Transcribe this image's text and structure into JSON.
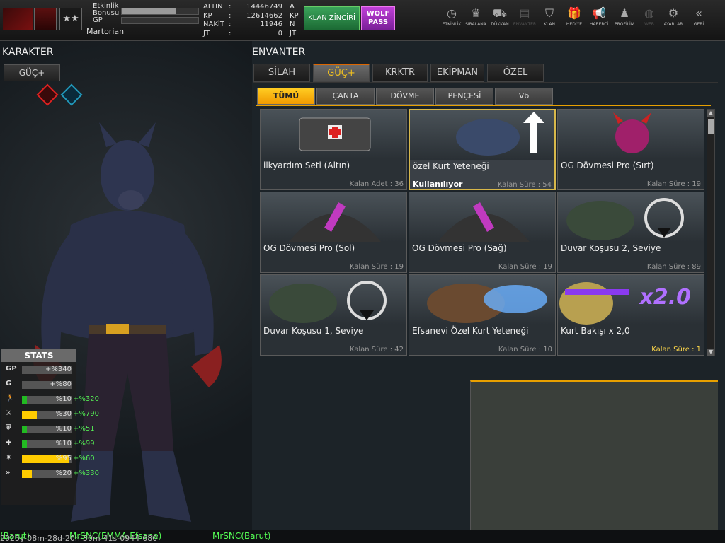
{
  "topbar": {
    "xp_labels": [
      "Etkinlik\nBonusu",
      "GP"
    ],
    "player_name": "Martorian",
    "currencies": [
      {
        "label": "ALTIN",
        "value": "14446749",
        "unit": "A"
      },
      {
        "label": "KP",
        "value": "12614662",
        "unit": "KP"
      },
      {
        "label": "NAKİT",
        "value": "11946",
        "unit": "N"
      },
      {
        "label": "JT",
        "value": "0",
        "unit": "JT"
      }
    ],
    "klan_button": "KLAN ZİNCİRİ",
    "wolf_button": "WOLF\nPASS",
    "bonus_bar_fill": 0.7,
    "gp_bar_fill": 0.0,
    "nav": [
      {
        "label": "ETKİNLİK",
        "icon": "clock-icon",
        "glyph": "◷"
      },
      {
        "label": "SIRALANA",
        "icon": "medal-icon",
        "glyph": "♛"
      },
      {
        "label": "DÜKKAN",
        "icon": "cart-icon",
        "glyph": "⛟"
      },
      {
        "label": "ENVANTER",
        "icon": "inventory-icon",
        "glyph": "▤"
      },
      {
        "label": "KLAN",
        "icon": "shield-icon",
        "glyph": "⛉"
      },
      {
        "label": "HEDİYE",
        "icon": "gift-icon",
        "glyph": "🎁"
      },
      {
        "label": "HABERCİ",
        "icon": "megaphone-icon",
        "glyph": "📢"
      },
      {
        "label": "PROFİLİM",
        "icon": "profile-icon",
        "glyph": "♟"
      },
      {
        "label": "WEB",
        "icon": "globe-icon",
        "glyph": "◍"
      },
      {
        "label": "AYARLAR",
        "icon": "gear-icon",
        "glyph": "⚙"
      },
      {
        "label": "GERİ",
        "icon": "back-icon",
        "glyph": "«"
      }
    ]
  },
  "left": {
    "title": "KARAKTER",
    "tab": "GÜÇ+",
    "stats_title": "STATS",
    "stats": [
      {
        "icon": "GP",
        "value": "+%340",
        "bonus": "",
        "fill": 0.0,
        "color": "#22bb22"
      },
      {
        "icon": "G",
        "value": "+%80",
        "bonus": "",
        "fill": 0.0,
        "color": "#22bb22"
      },
      {
        "icon": "run-icon",
        "value": "%10",
        "bonus": "+%320",
        "fill": 0.1,
        "color": "#22bb22"
      },
      {
        "icon": "attack-icon",
        "value": "%30",
        "bonus": "+%790",
        "fill": 0.3,
        "color": "#ffcc00"
      },
      {
        "icon": "defense-icon",
        "value": "%10",
        "bonus": "+%51",
        "fill": 0.1,
        "color": "#22bb22"
      },
      {
        "icon": "heal-icon",
        "value": "%10",
        "bonus": "+%99",
        "fill": 0.1,
        "color": "#22bb22"
      },
      {
        "icon": "skill-icon",
        "value": "%95",
        "bonus": "+%60",
        "fill": 0.95,
        "color": "#ffcc00"
      },
      {
        "icon": "speed-icon",
        "value": "%20",
        "bonus": "+%330",
        "fill": 0.2,
        "color": "#ffcc00"
      }
    ]
  },
  "right": {
    "title": "ENVANTER",
    "main_tabs": [
      "SİLAH",
      "GÜÇ+",
      "KRKTR",
      "EKİPMAN",
      "ÖZEL"
    ],
    "active_main_tab": 1,
    "sub_tabs": [
      "TÜMÜ",
      "ÇANTA",
      "DÖVME",
      "PENÇESİ",
      "Vb"
    ],
    "active_sub_tab": 0,
    "items": [
      {
        "name": "ilkyardım Seti (Altın)",
        "time": "Kalan Adet : 36",
        "status": "",
        "icon": "medkit-icon",
        "highlight": false
      },
      {
        "name": "özel Kurt Yeteneği",
        "time": "Kalan Süre : 54",
        "status": "Kullanılıyor",
        "icon": "wolf-skill-icon",
        "highlight": false
      },
      {
        "name": "OG Dövmesi Pro (Sırt)",
        "time": "Kalan Süre : 19",
        "status": "",
        "icon": "tattoo-back-icon",
        "highlight": false
      },
      {
        "name": "OG Dövmesi Pro (Sol)",
        "time": "Kalan Süre : 19",
        "status": "",
        "icon": "tattoo-left-icon",
        "highlight": false
      },
      {
        "name": "OG Dövmesi Pro (Sağ)",
        "time": "Kalan Süre : 19",
        "status": "",
        "icon": "tattoo-right-icon",
        "highlight": false
      },
      {
        "name": "Duvar Koşusu 2, Seviye",
        "time": "Kalan Süre : 89",
        "status": "",
        "icon": "wallrun-icon",
        "highlight": false
      },
      {
        "name": "Duvar Koşusu 1, Seviye",
        "time": "Kalan Süre : 42",
        "status": "",
        "icon": "wallrun-icon",
        "highlight": false
      },
      {
        "name": "Efsanevi Özel Kurt Yeteneği",
        "time": "Kalan Süre : 10",
        "status": "",
        "icon": "legendary-wolf-icon",
        "highlight": false
      },
      {
        "name": "Kurt Bakışı x 2,0",
        "time": "Kalan Süre : 1",
        "status": "",
        "icon": "wolf-gaze-icon",
        "highlight": true,
        "badge": "x2.0"
      }
    ]
  },
  "bottom": {
    "chat": [
      "(Barut)",
      "MrSNC(EMMA Efsane)",
      "MrSNC(Barut)"
    ],
    "timestamp": "2025y-08m-28d-20h-30m-41s-0944-680"
  }
}
